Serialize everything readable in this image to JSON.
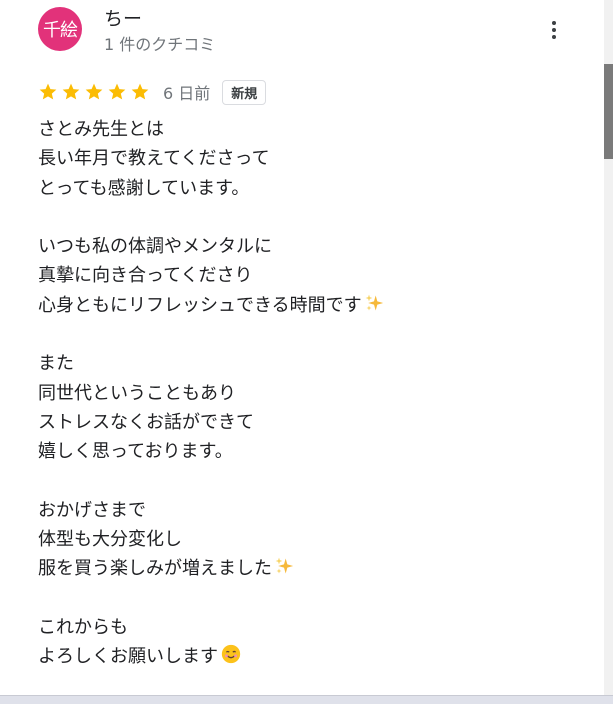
{
  "reviewer": {
    "avatar_text": "千絵",
    "name": "ちー",
    "review_count": "1 件のクチコミ"
  },
  "rating": {
    "stars": 5,
    "max_stars": 5,
    "date": "6 日前",
    "badge": "新規",
    "star_color": "#fbbc04"
  },
  "review": {
    "lines": [
      "さとみ先生とは",
      "長い年月で教えてくださって",
      "とっても感謝しています。",
      "",
      "いつも私の体調やメンタルに",
      "真摯に向き合ってくださり",
      "心身ともにリフレッシュできる時間です",
      "",
      "また",
      "同世代ということもあり",
      "ストレスなくお話ができて",
      "嬉しく思っております。",
      "",
      "おかげさまで",
      "体型も大分変化し",
      "服を買う楽しみが増えました",
      "",
      "これからも",
      "よろしくお願いします"
    ]
  },
  "icons": {
    "more": "more-vert-icon",
    "star": "star-icon",
    "sparkles": "sparkles-icon",
    "smile": "smiling-face-icon"
  },
  "colors": {
    "avatar_bg": "#e2327a",
    "text_primary": "#202124",
    "text_secondary": "#70757a"
  }
}
